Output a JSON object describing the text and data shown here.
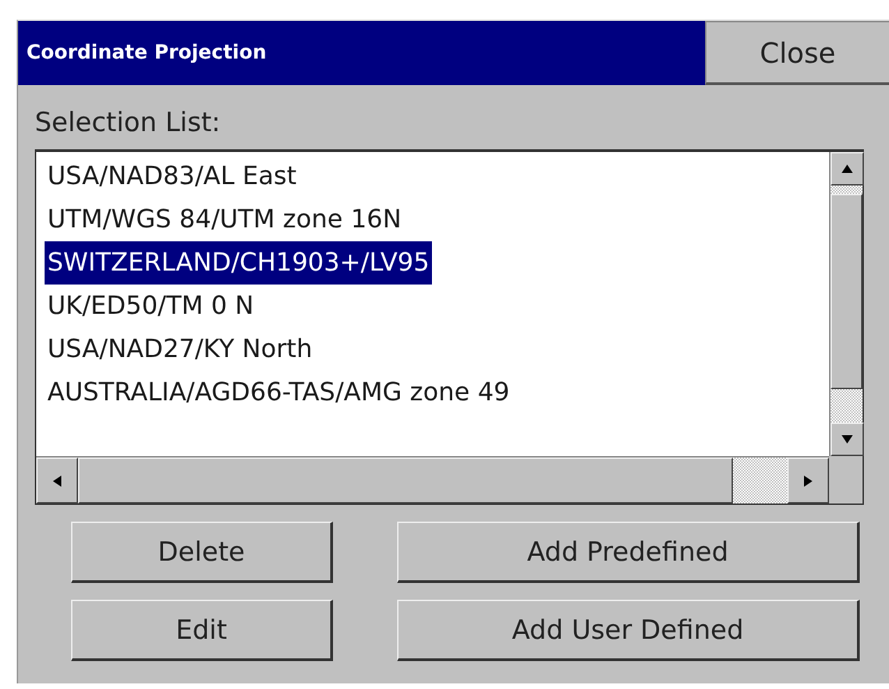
{
  "window": {
    "title": "Coordinate Projection",
    "close_button": "Close"
  },
  "selection_list": {
    "label": "Selection List:",
    "items": [
      {
        "text": "USA/NAD83/AL East",
        "selected": false
      },
      {
        "text": "UTM/WGS 84/UTM zone 16N",
        "selected": false
      },
      {
        "text": "SWITZERLAND/CH1903+/LV95",
        "selected": true
      },
      {
        "text": "UK/ED50/TM 0 N",
        "selected": false
      },
      {
        "text": "USA/NAD27/KY North",
        "selected": false
      },
      {
        "text": "AUSTRALIA/AGD66-TAS/AMG zone 49",
        "selected": false
      }
    ]
  },
  "buttons": [
    "Delete",
    "Add Predefined",
    "Edit",
    "Add User Defined"
  ]
}
